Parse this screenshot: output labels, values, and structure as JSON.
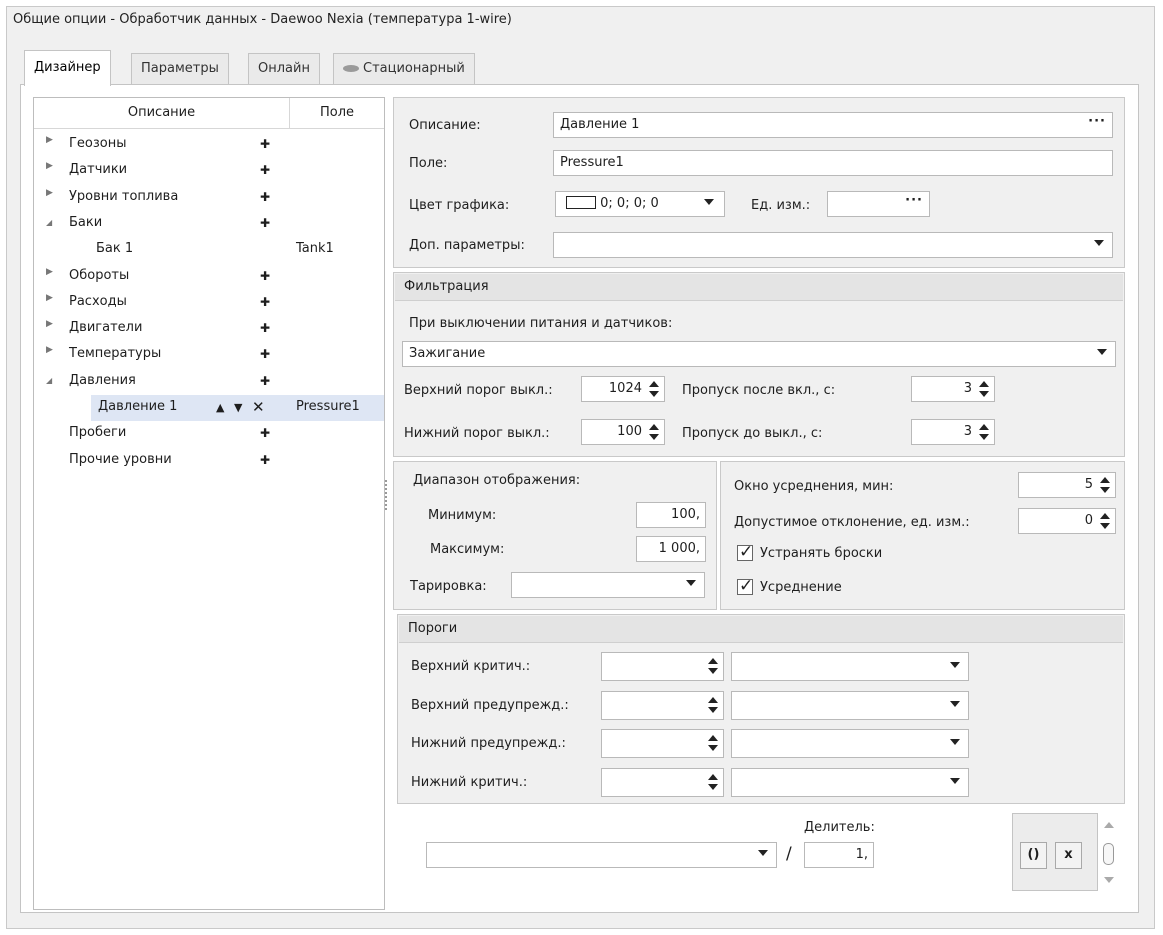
{
  "window": {
    "title": "Общие опции - Обработчик данных - Daewoo Nexia (температура 1-wire)"
  },
  "tabs": [
    {
      "label": "Дизайнер",
      "active": true
    },
    {
      "label": "Параметры"
    },
    {
      "label": "Онлайн"
    },
    {
      "label": "Стационарный",
      "icon": "device-icon"
    }
  ],
  "tree": {
    "col_description": "Описание",
    "col_field": "Поле",
    "items": [
      {
        "label": "Геозоны",
        "expand": "▶",
        "action": "✚",
        "field": ""
      },
      {
        "label": "Датчики",
        "expand": "▶",
        "action": "✚",
        "field": ""
      },
      {
        "label": "Уровни топлива",
        "expand": "▶",
        "action": "✚",
        "field": ""
      },
      {
        "label": "Баки",
        "expand": "◢",
        "action": "✚",
        "field": ""
      },
      {
        "label": "Бак 1",
        "expand": "",
        "action": "",
        "field": "Tank1"
      },
      {
        "label": "Обороты",
        "expand": "▶",
        "action": "✚",
        "field": ""
      },
      {
        "label": "Расходы",
        "expand": "▶",
        "action": "✚",
        "field": ""
      },
      {
        "label": "Двигатели",
        "expand": "▶",
        "action": "✚",
        "field": ""
      },
      {
        "label": "Температуры",
        "expand": "▶",
        "action": "✚",
        "field": ""
      },
      {
        "label": "Давления",
        "expand": "◢",
        "action": "✚",
        "field": ""
      },
      {
        "label": "Давление 1",
        "expand": "",
        "action": "",
        "field": "Pressure1"
      },
      {
        "label": "Пробеги",
        "expand": "",
        "action": "✚",
        "field": ""
      },
      {
        "label": "Прочие уровни",
        "expand": "",
        "action": "✚",
        "field": ""
      }
    ],
    "selected_controls": {
      "up": "▲",
      "down": "▼",
      "remove": "✕"
    }
  },
  "props": {
    "description_label": "Описание:",
    "description_value": "Давление 1",
    "field_label": "Поле:",
    "field_value": "Pressure1",
    "color_label": "Цвет графика:",
    "color_value": "0; 0; 0; 0",
    "units_label": "Ед. изм.:",
    "units_value": "",
    "extra_label": "Доп. параметры:",
    "extra_value": "",
    "ellipsis": "···"
  },
  "filter": {
    "header": "Фильтрация",
    "power_label": "При выключении питания и датчиков:",
    "power_value": "Зажигание",
    "upper_off_label": "Верхний порог выкл.:",
    "upper_off_value": "1024",
    "lower_off_label": "Нижний порог выкл.:",
    "lower_off_value": "100",
    "skip_after_on_label": "Пропуск после вкл., с:",
    "skip_after_on_value": "3",
    "skip_before_off_label": "Пропуск до выкл., с:",
    "skip_before_off_value": "3"
  },
  "display": {
    "range_label": "Диапазон отображения:",
    "min_label": "Минимум:",
    "min_value": "100,",
    "max_label": "Максимум:",
    "max_value": "1 000,",
    "calib_label": "Тарировка:",
    "calib_value": ""
  },
  "averaging": {
    "window_label": "Окно усреднения, мин:",
    "window_value": "5",
    "deviation_label": "Допустимое отклонение, ед. изм.:",
    "deviation_value": "0",
    "spikes_label": "Устранять броски",
    "spikes_checked": true,
    "avg_label": "Усреднение",
    "avg_checked": true
  },
  "thresholds": {
    "header": "Пороги",
    "rows": [
      {
        "label": "Верхний критич.:",
        "value": "",
        "select": ""
      },
      {
        "label": "Верхний предупрежд.:",
        "value": "",
        "select": ""
      },
      {
        "label": "Нижний предупрежд.:",
        "value": "",
        "select": ""
      },
      {
        "label": "Нижний критич.:",
        "value": "",
        "select": ""
      }
    ]
  },
  "formula": {
    "source_value": "",
    "slash": "/",
    "divider_label": "Делитель:",
    "divider_value": "1,",
    "paren_button": "()",
    "clear_button": "x"
  }
}
